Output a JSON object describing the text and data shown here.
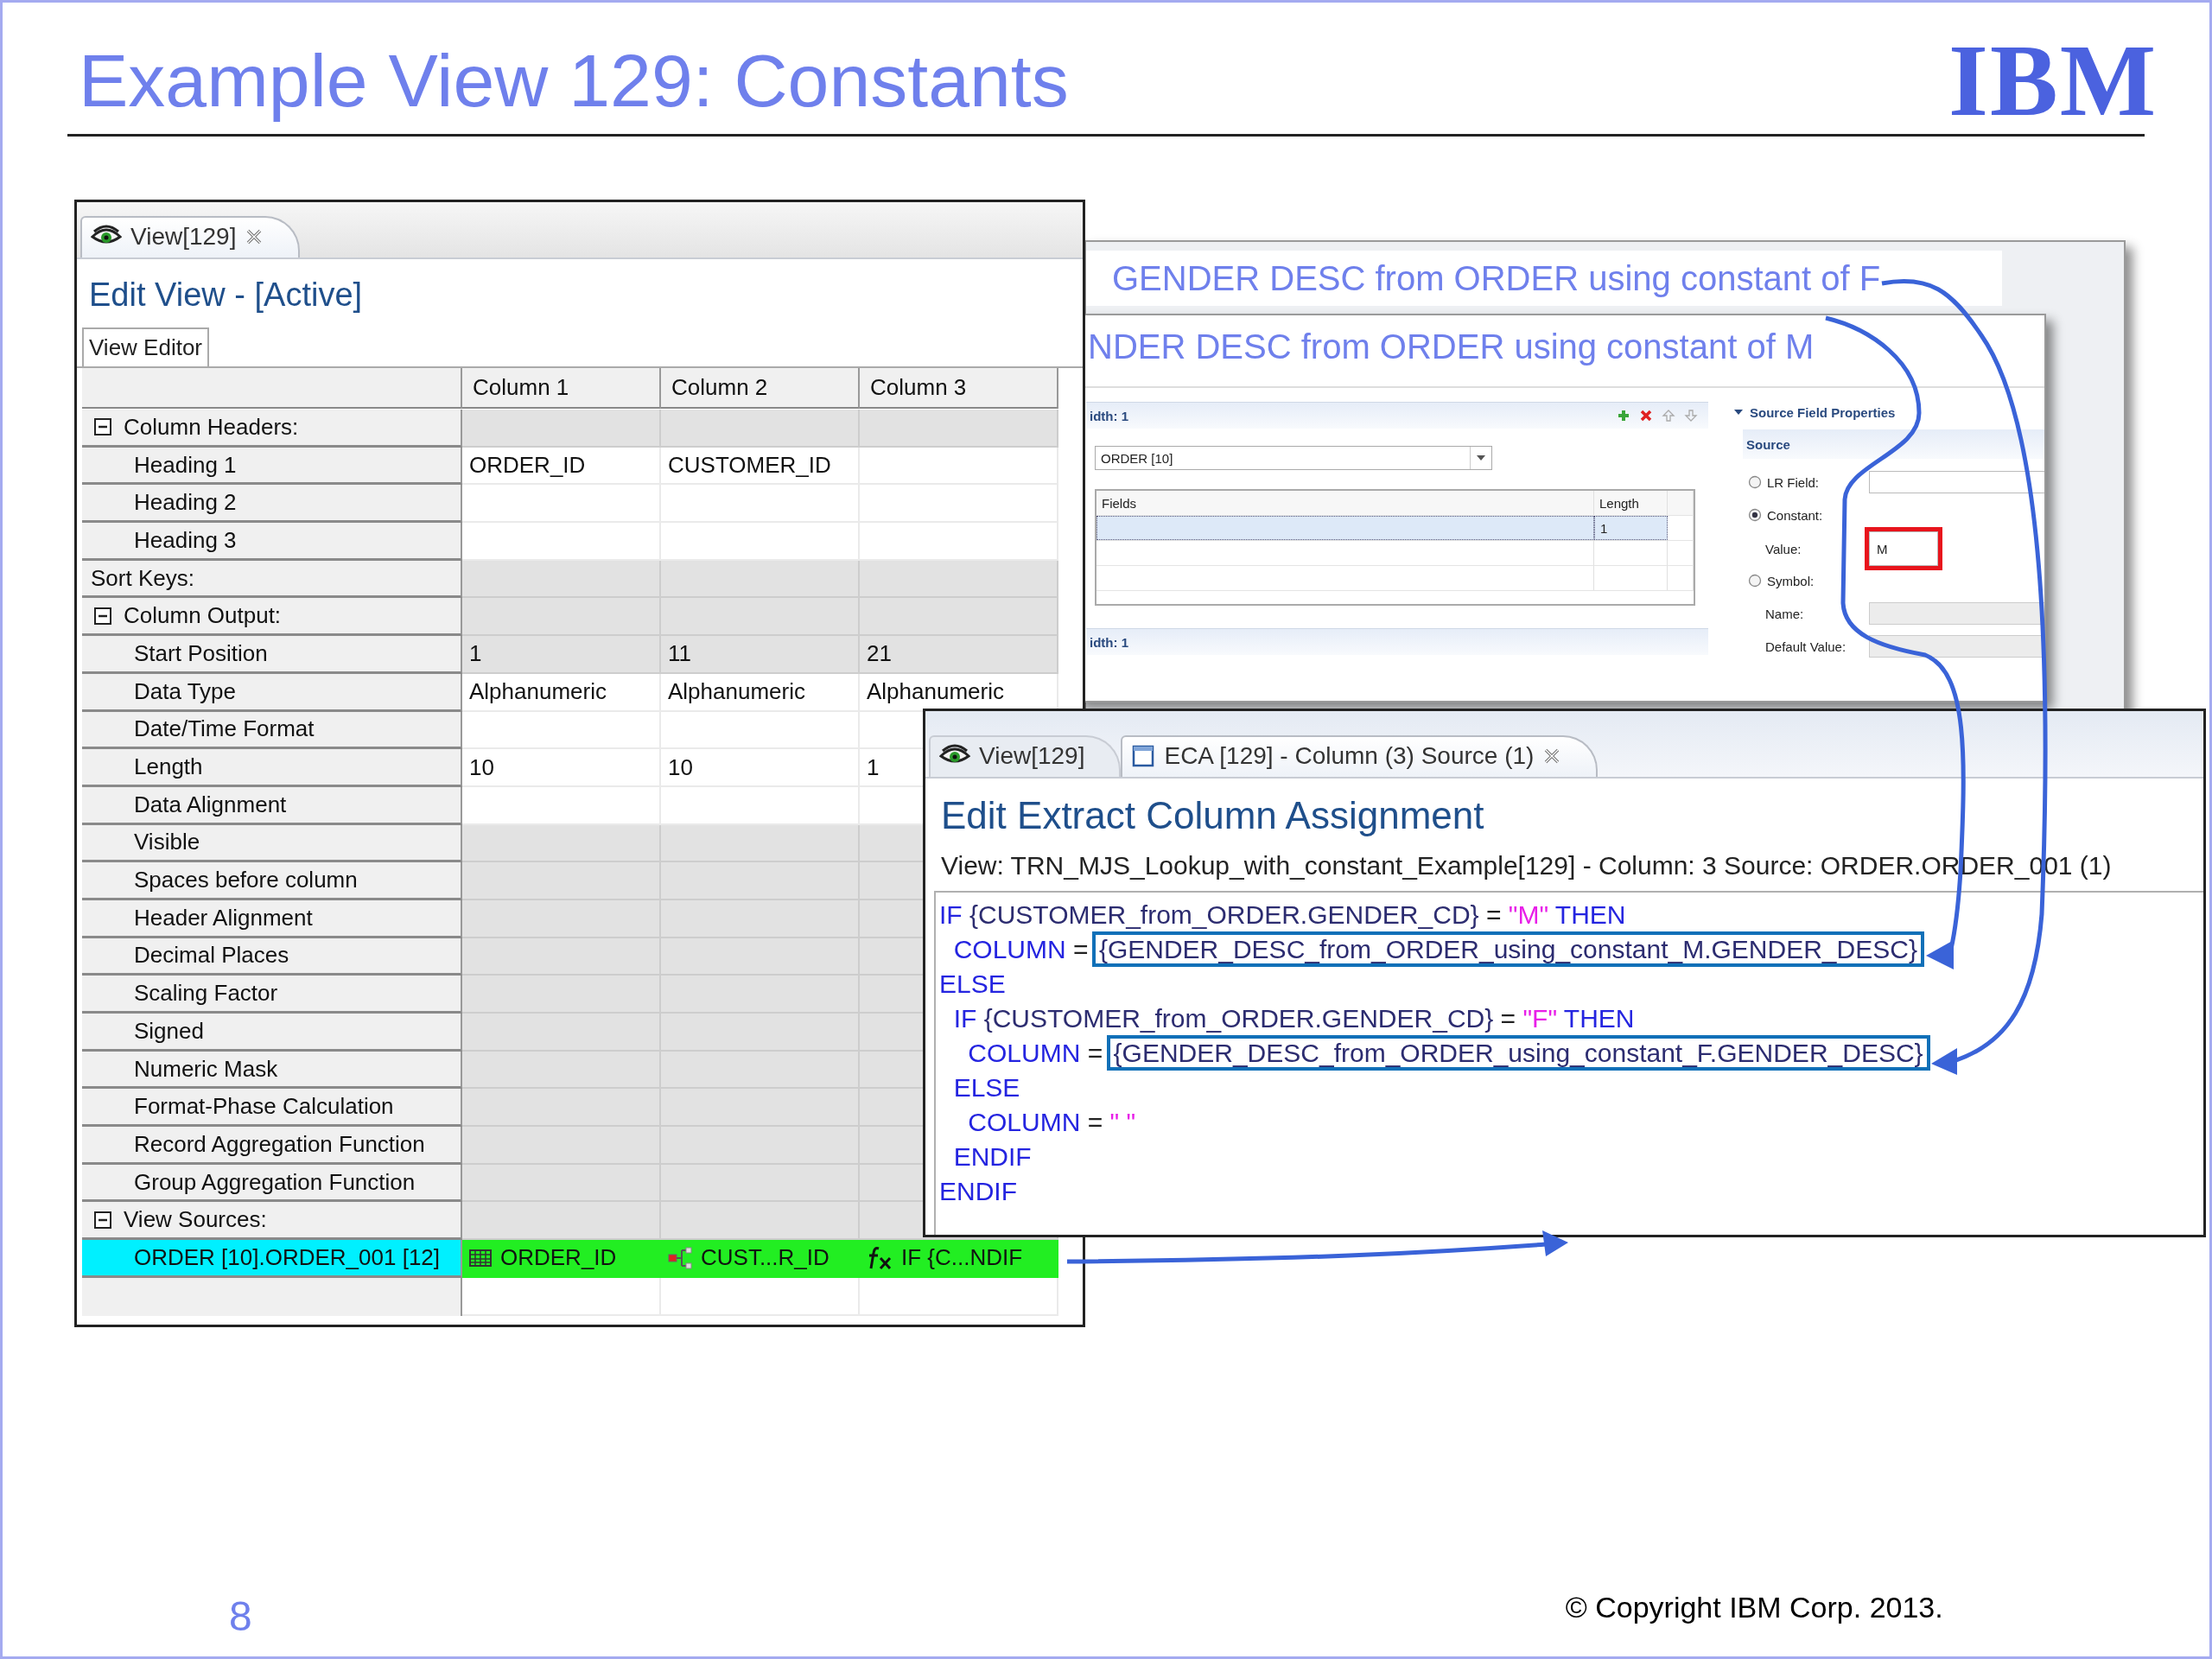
{
  "slide": {
    "title": "Example View 129: Constants",
    "logo": "IBM",
    "page_number": "8",
    "copyright": "© Copyright IBM Corp. 2013."
  },
  "view_window": {
    "tabs": [
      {
        "label": "View[129]",
        "kind": "view",
        "selected": true,
        "closable": true
      }
    ],
    "heading": "Edit View - [Active]",
    "editor_tabs": [
      {
        "label": "View Editor",
        "selected": true
      }
    ],
    "columns": [
      "Column 1",
      "Column 2",
      "Column 3"
    ],
    "rows": [
      {
        "label": "Column Headers:",
        "kind": "group",
        "expanded": true,
        "editable": false,
        "children": [
          {
            "label": "Heading 1",
            "kind": "item",
            "editable": true,
            "cells": {
              "column_1": "ORDER_ID",
              "column_2": "CUSTOMER_ID"
            }
          },
          {
            "label": "Heading 2",
            "kind": "item",
            "editable": true
          },
          {
            "label": "Heading 3",
            "kind": "item",
            "editable": true
          }
        ]
      },
      {
        "label": "Sort Keys:",
        "kind": "group",
        "editable": false
      },
      {
        "label": "Column Output:",
        "kind": "group",
        "expanded": true,
        "editable": false,
        "children": [
          {
            "label": "Start Position",
            "kind": "item",
            "editable": false,
            "cells": {
              "column_1": "1",
              "column_2": "11",
              "column_3": "21"
            }
          },
          {
            "label": "Data Type",
            "kind": "item",
            "editable": true,
            "cells": {
              "column_1": "Alphanumeric",
              "column_2": "Alphanumeric",
              "column_3": "Alphanumeric"
            }
          },
          {
            "label": "Date/Time Format",
            "kind": "item",
            "editable": true
          },
          {
            "label": "Length",
            "kind": "item",
            "editable": true,
            "cells": {
              "column_1": "10",
              "column_2": "10",
              "column_3": "1"
            }
          },
          {
            "label": "Data Alignment",
            "kind": "item",
            "editable": true
          },
          {
            "label": "Visible",
            "kind": "item",
            "editable": false
          },
          {
            "label": "Spaces before column",
            "kind": "item",
            "editable": false
          },
          {
            "label": "Header Alignment",
            "kind": "item",
            "editable": false
          },
          {
            "label": "Decimal Places",
            "kind": "item",
            "editable": false
          },
          {
            "label": "Scaling Factor",
            "kind": "item",
            "editable": false
          },
          {
            "label": "Signed",
            "kind": "item",
            "editable": false
          },
          {
            "label": "Numeric Mask",
            "kind": "item",
            "editable": false
          },
          {
            "label": "Format-Phase Calculation",
            "kind": "item",
            "editable": false
          },
          {
            "label": "Record Aggregation Function",
            "kind": "item",
            "editable": false
          },
          {
            "label": "Group Aggregation Function",
            "kind": "item",
            "editable": false
          }
        ]
      },
      {
        "label": "View Sources:",
        "kind": "group",
        "expanded": true,
        "editable": false,
        "children": [
          {
            "label": "ORDER [10].ORDER_001 [12]",
            "kind": "source",
            "selected": true,
            "source_cells": [
              {
                "text": "ORDER_ID",
                "kind": "field"
              },
              {
                "text": "CUST...R_ID",
                "kind": "lookup"
              },
              {
                "text": "IF {C...NDIF",
                "kind": "formula"
              }
            ]
          }
        ]
      }
    ]
  },
  "lookup_window_f": {
    "title": "GENDER DESC from ORDER using constant of F"
  },
  "lookup_window_m": {
    "title": "NDER DESC from ORDER using constant of M",
    "section_header": "idth: 1",
    "source": "ORDER [10]",
    "fields_table": {
      "columns": [
        "Fields",
        "Length"
      ],
      "rows": [
        {
          "length": "1",
          "selected": true
        }
      ]
    },
    "second_section_header": "idth: 1",
    "properties": {
      "header": "Source Field Properties",
      "expanded": true,
      "group": "Source",
      "rows": [
        {
          "kind": "radio",
          "label": "LR Field:",
          "selected": false,
          "input_disabled": false
        },
        {
          "kind": "radio",
          "label": "Constant:",
          "selected": true
        },
        {
          "kind": "input",
          "label": "Value:",
          "value": "M",
          "input_disabled": false,
          "flagged": true
        },
        {
          "kind": "radio",
          "label": "Symbol:",
          "selected": false
        },
        {
          "kind": "input",
          "label": "Name:",
          "input_disabled": true
        },
        {
          "kind": "input",
          "label": "Default Value:",
          "input_disabled": true
        }
      ]
    }
  },
  "eca_window": {
    "tabs": [
      {
        "label": "View[129]",
        "kind": "view",
        "selected": false,
        "closable": false
      },
      {
        "label": "ECA [129] - Column (3) Source (1)",
        "kind": "assignment",
        "selected": true,
        "closable": true
      }
    ],
    "heading": "Edit Extract Column Assignment",
    "info": "View: TRN_MJS_Lookup_with_constant_Example[129] - Column: 3 Source: ORDER.ORDER_001 (1)",
    "code": [
      {
        "tokens": [
          {
            "text": "IF ",
            "kind": "keyword"
          },
          {
            "text": "{CUSTOMER_from_ORDER.GENDER_CD}",
            "kind": "field"
          },
          {
            "text": " = ",
            "kind": "operator"
          },
          {
            "text": "\"M\"",
            "kind": "string"
          },
          {
            "text": " THEN",
            "kind": "keyword"
          }
        ]
      },
      {
        "tokens": [
          {
            "text": "  COLUMN",
            "kind": "keyword"
          },
          {
            "text": " = ",
            "kind": "operator"
          },
          {
            "text": "{GENDER_DESC_from_ORDER_using_constant_M.GENDER_DESC}",
            "kind": "field",
            "boxed": true
          }
        ]
      },
      {
        "tokens": [
          {
            "text": "ELSE",
            "kind": "keyword"
          }
        ]
      },
      {
        "tokens": [
          {
            "text": "  IF ",
            "kind": "keyword"
          },
          {
            "text": "{CUSTOMER_from_ORDER.GENDER_CD}",
            "kind": "field"
          },
          {
            "text": " = ",
            "kind": "operator"
          },
          {
            "text": "\"F\"",
            "kind": "string"
          },
          {
            "text": " THEN",
            "kind": "keyword"
          }
        ]
      },
      {
        "tokens": [
          {
            "text": "    COLUMN",
            "kind": "keyword"
          },
          {
            "text": " = ",
            "kind": "operator"
          },
          {
            "text": "{GENDER_DESC_from_ORDER_using_constant_F.GENDER_DESC}",
            "kind": "field",
            "boxed": true
          }
        ]
      },
      {
        "tokens": [
          {
            "text": "  ELSE",
            "kind": "keyword"
          }
        ]
      },
      {
        "tokens": [
          {
            "text": "    COLUMN",
            "kind": "keyword"
          },
          {
            "text": " = ",
            "kind": "operator"
          },
          {
            "text": "\" \"",
            "kind": "string"
          }
        ]
      },
      {
        "tokens": [
          {
            "text": "  ENDIF",
            "kind": "keyword"
          }
        ]
      },
      {
        "tokens": [
          {
            "text": "ENDIF",
            "kind": "keyword"
          }
        ]
      }
    ]
  }
}
